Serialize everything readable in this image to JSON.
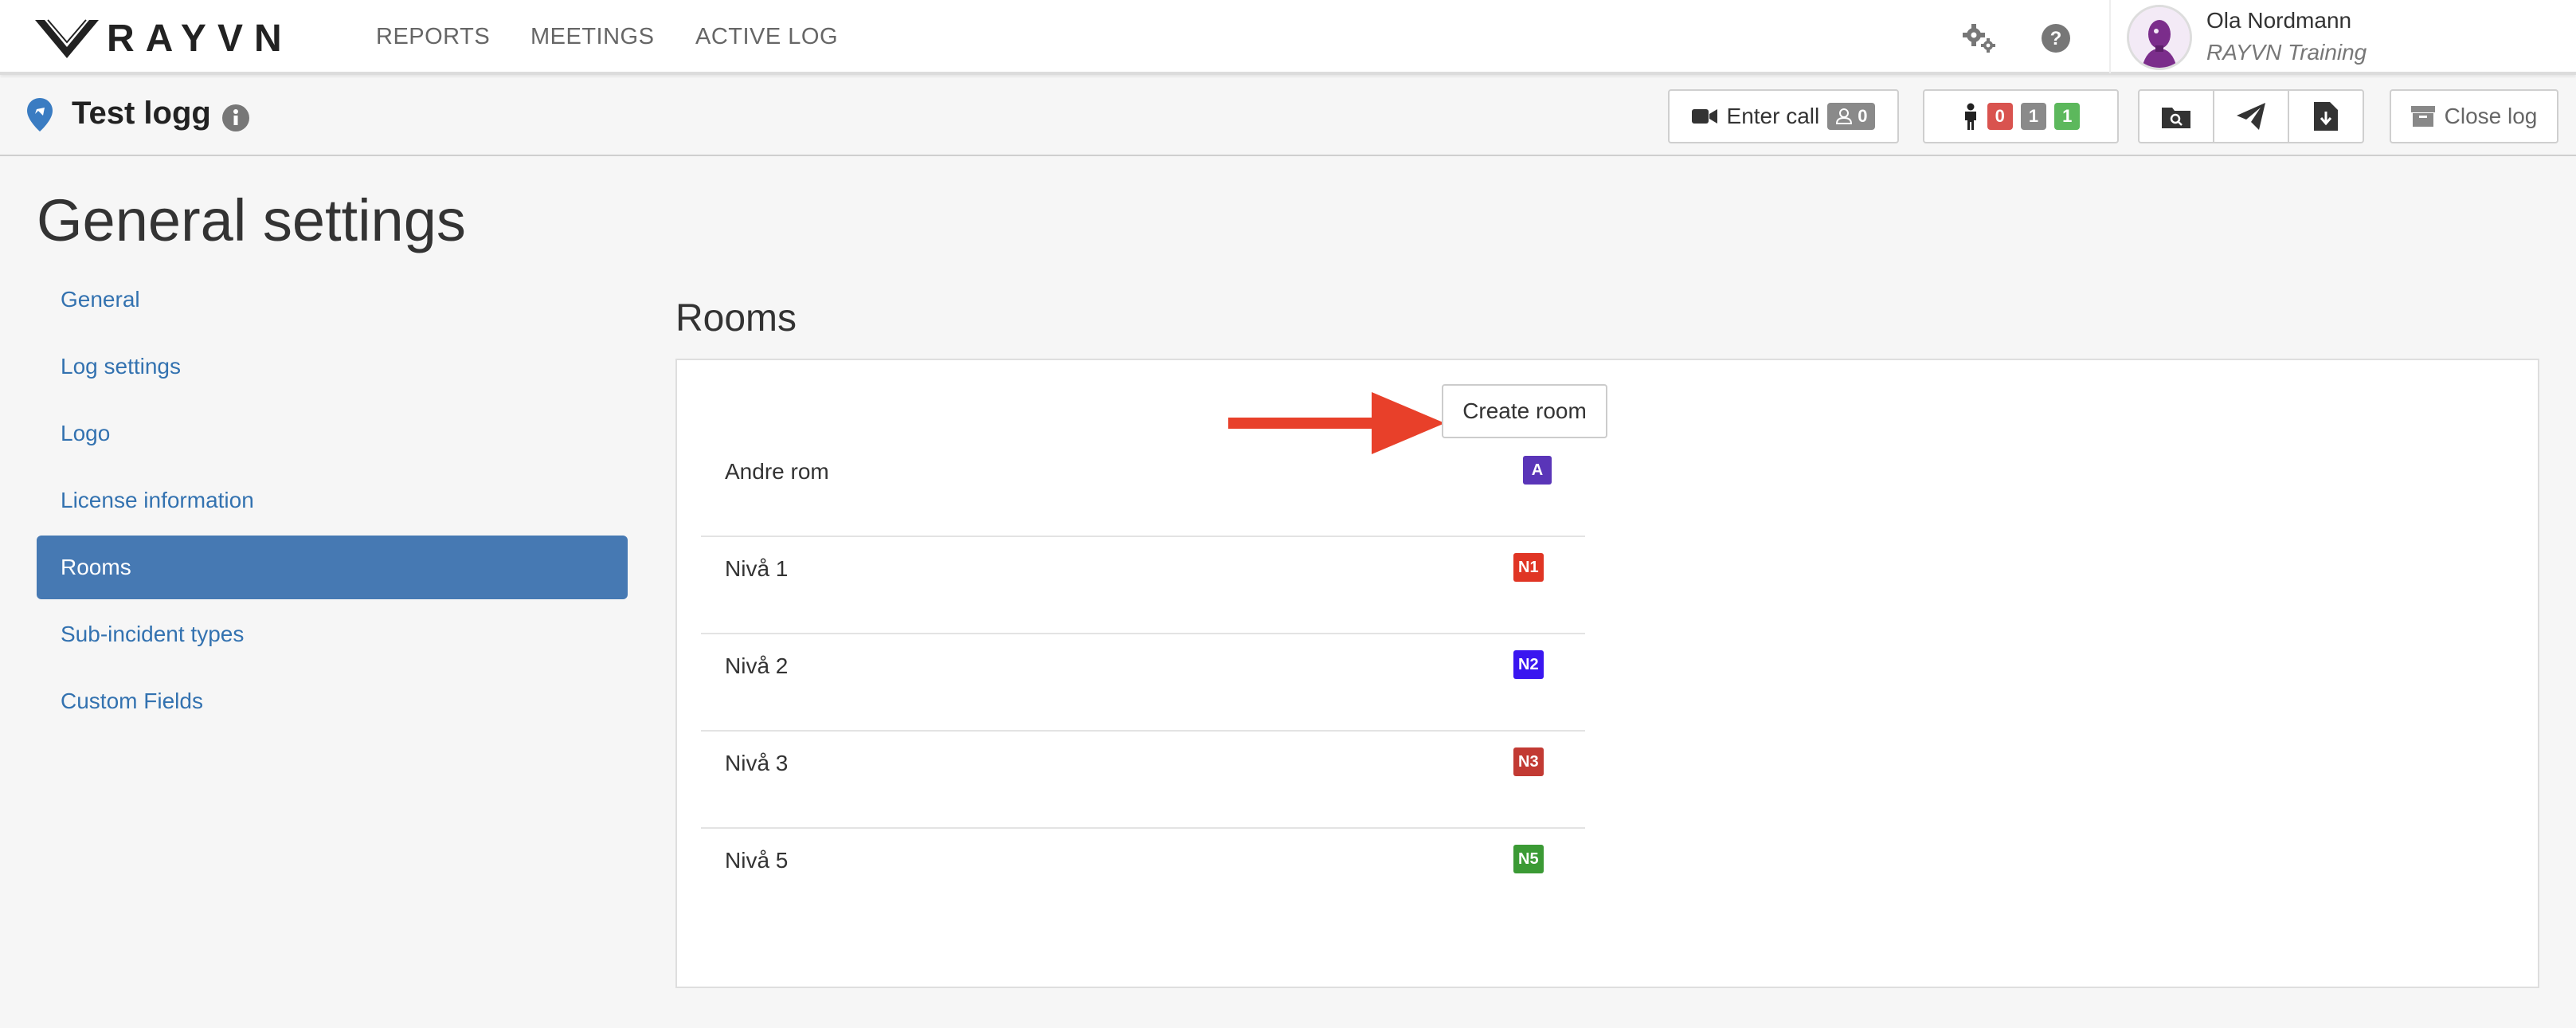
{
  "app": {
    "logo_text": "RAYVN",
    "nav": [
      "REPORTS",
      "MEETINGS",
      "ACTIVE LOG"
    ]
  },
  "user": {
    "name": "Ola Nordmann",
    "org": "RAYVN Training"
  },
  "log": {
    "title": "Test logg",
    "enter_call_label": "Enter call",
    "call_count": "0",
    "status_counts": [
      "0",
      "1",
      "1"
    ],
    "close_label": "Close log"
  },
  "page": {
    "title": "General settings",
    "sidenav": [
      "General",
      "Log settings",
      "Logo",
      "License information",
      "Rooms",
      "Sub-incident types",
      "Custom Fields"
    ],
    "active_index": 4,
    "section_title": "Rooms",
    "create_button": "Create room"
  },
  "rooms": [
    {
      "name": "Andre rom",
      "code": "A",
      "color": "#5a35b8"
    },
    {
      "name": "Nivå 1",
      "code": "N1",
      "color": "#e03524"
    },
    {
      "name": "Nivå 2",
      "code": "N2",
      "color": "#3a16f0"
    },
    {
      "name": "Nivå 3",
      "code": "N3",
      "color": "#c23a33"
    },
    {
      "name": "Nivå 5",
      "code": "N5",
      "color": "#3b9a35"
    }
  ],
  "colors": {
    "accent": "#4679b3",
    "link": "#3372b0",
    "arrow": "#e8402a",
    "badge_red": "#d9534f",
    "badge_gray": "#8a8a8a",
    "badge_green": "#5cb85c"
  }
}
